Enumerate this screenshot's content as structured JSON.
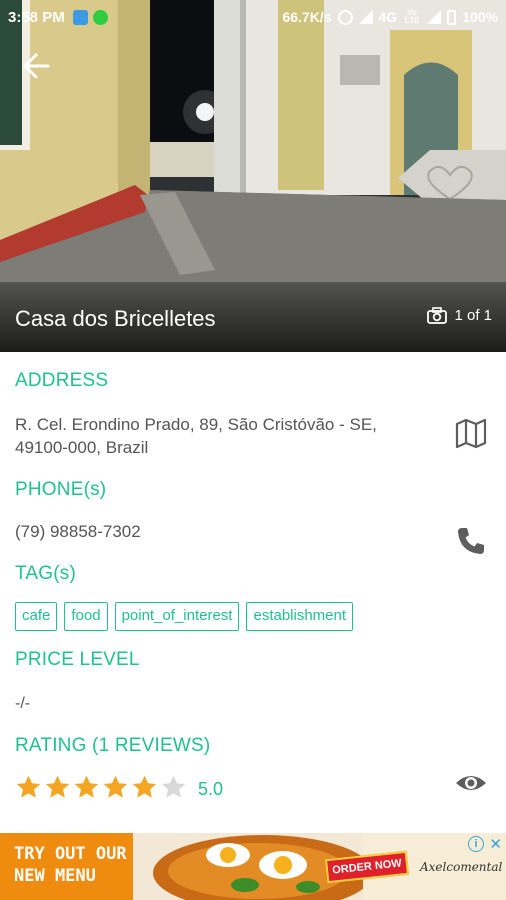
{
  "status_bar": {
    "time": "3:58 PM",
    "speed": "66.7K/s",
    "network": "4G",
    "volte": "Vo LTE",
    "battery": "100%",
    "icons": [
      "google-maps-notification-icon",
      "wechat-notification-icon",
      "alarm-icon",
      "signal-icon",
      "battery-icon"
    ]
  },
  "hero": {
    "place_name": "Casa dos Bricelletes",
    "photo_counter": "1 of 1"
  },
  "address": {
    "title": "ADDRESS",
    "line1": "R. Cel. Erondino Prado, 89, São Cristóvão - SE,",
    "line2": "49100-000, Brazil"
  },
  "phone": {
    "title": "PHONE(s)",
    "number": "(79) 98858-7302"
  },
  "tags": {
    "title": "TAG(s)",
    "items": [
      "cafe",
      "food",
      "point_of_interest",
      "establishment"
    ]
  },
  "price": {
    "title": "PRICE LEVEL",
    "value": "-/-"
  },
  "rating": {
    "title": "RATING (1 REVIEWS)",
    "value": "5.0",
    "filled_stars": 5,
    "max_stars": 6
  },
  "ad": {
    "headline": "TRY OUT OUR\nNEW MENU",
    "button": "ORDER NOW",
    "brand": "Axelcomental",
    "info": "i",
    "close": "✕"
  },
  "colors": {
    "accent": "#1fc28b",
    "star_filled": "#f4a623",
    "star_empty": "#d8d8d8"
  }
}
